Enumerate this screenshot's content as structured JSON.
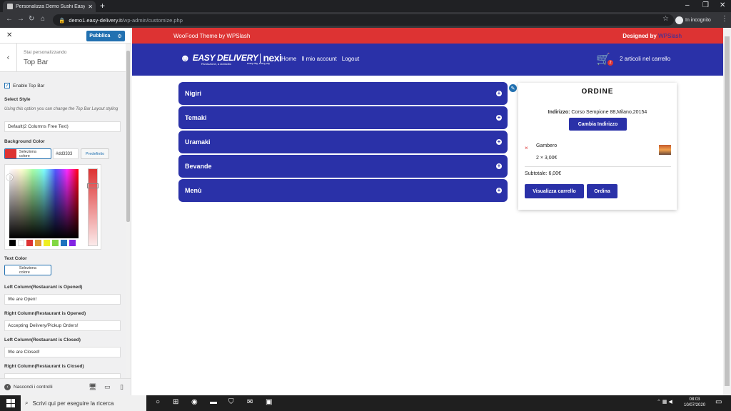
{
  "browser": {
    "tab_title": "Personalizza Demo Sushi Easy De",
    "url_host": "demo1.easy-delivery.it",
    "url_path": "/wp-admin/customize.php",
    "incognito_label": "In incognito"
  },
  "customizer": {
    "publish_label": "Pubblica",
    "breadcrumb_sub": "Stai personalizzando",
    "section_title": "Top Bar",
    "enable_label": "Enable Top Bar",
    "select_style_label": "Select Style",
    "select_style_desc": "Using this option you can change the Top Bar Layout styling",
    "select_style_value": "Default(2 Columns Free Text)",
    "bg_color_label": "Background Color",
    "bg_color_button": "Seleziona colore",
    "bg_color_hex": "#dd3333",
    "bg_color_default": "Predefinito",
    "text_color_label": "Text Color",
    "text_color_button": "Seleziona colore",
    "left_open_label": "Left Column(Restaurant is Opened)",
    "left_open_value": "We are Open!",
    "right_open_label": "Right Column(Restaurant is Opened)",
    "right_open_value": "Accepting Delivery/Pickup Orders!",
    "left_closed_label": "Left Column(Restaurant is Closed)",
    "left_closed_value": "We are Closed!",
    "right_closed_label": "Right Column(Restaurant is Closed)",
    "hide_controls_label": "Nascondi i controlli",
    "palette": [
      "#000000",
      "#ffffff",
      "#dd3333",
      "#dd9933",
      "#eeee22",
      "#81d742",
      "#1e73be",
      "#8224e3"
    ]
  },
  "site": {
    "topbar_left": "WooFood Theme by WPSlash",
    "topbar_right_prefix": "Designed by",
    "topbar_right_link": "WPSlash",
    "logo_main": "EASY DELIVERY",
    "logo_brand": "nexi",
    "logo_tagline": "Rivoluzione, a domicilio",
    "logo_brand_tagline": "every day, every pay",
    "nav": [
      "Home",
      "Il mio account",
      "Logout"
    ],
    "cart_count": "2",
    "cart_text": "2 articoli nel carrello",
    "categories": [
      "Nigiri",
      "Temaki",
      "Uramaki",
      "Bevande",
      "Menù"
    ]
  },
  "order": {
    "title": "ORDINE",
    "address_label": "Indirizzo:",
    "address_value": "Corso Sempione 88,Milano,20154",
    "change_address": "Cambia Indirizzo",
    "item_name": "Gambero",
    "item_qty": "2 × 3,00€",
    "subtotal": "Subtotale: 6,00€",
    "view_cart": "Visualizza carrello",
    "checkout": "Ordina"
  },
  "taskbar": {
    "search_placeholder": "Scrivi qui per eseguire la ricerca",
    "time": "08:03",
    "date": "10/07/2020"
  },
  "colors": {
    "accent": "#2a31a8",
    "topbar": "#dd3333",
    "wp_blue": "#2271b1"
  }
}
